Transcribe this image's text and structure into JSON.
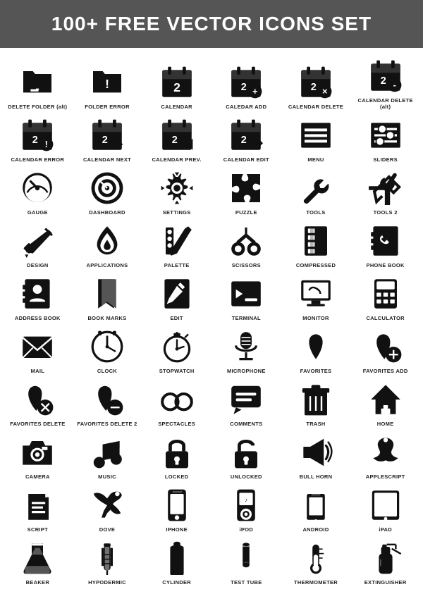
{
  "header": "100+ FREE VECTOR ICONS SET",
  "icons": [
    {
      "name": "DELETE FOLDER (alt)",
      "id": "delete-folder-alt"
    },
    {
      "name": "FOLDER ERROR",
      "id": "folder-error"
    },
    {
      "name": "CALENDAR",
      "id": "calendar"
    },
    {
      "name": "CALEDAR ADD",
      "id": "calendar-add"
    },
    {
      "name": "CALENDAR DELETE",
      "id": "calendar-delete"
    },
    {
      "name": "CALENDAR DELETE (alt)",
      "id": "calendar-delete-alt"
    },
    {
      "name": "CALENDAR ERROR",
      "id": "calendar-error"
    },
    {
      "name": "CALENDAR NEXT",
      "id": "calendar-next"
    },
    {
      "name": "CALENDAR PREV.",
      "id": "calendar-prev"
    },
    {
      "name": "CALENDAR EDIT",
      "id": "calendar-edit"
    },
    {
      "name": "MENU",
      "id": "menu"
    },
    {
      "name": "SLIDERS",
      "id": "sliders"
    },
    {
      "name": "GAUGE",
      "id": "gauge"
    },
    {
      "name": "DASHBOARD",
      "id": "dashboard"
    },
    {
      "name": "SETTINGS",
      "id": "settings"
    },
    {
      "name": "PUZZLE",
      "id": "puzzle"
    },
    {
      "name": "TOOLS",
      "id": "tools"
    },
    {
      "name": "TOOLS 2",
      "id": "tools2"
    },
    {
      "name": "DESIGN",
      "id": "design"
    },
    {
      "name": "APPLICATIONS",
      "id": "applications"
    },
    {
      "name": "PALETTE",
      "id": "palette"
    },
    {
      "name": "SCISSORS",
      "id": "scissors"
    },
    {
      "name": "COMPRESSED",
      "id": "compressed"
    },
    {
      "name": "PHONE BOOK",
      "id": "phone-book"
    },
    {
      "name": "ADDRESS BOOK",
      "id": "address-book"
    },
    {
      "name": "BOOK MARKS",
      "id": "bookmarks"
    },
    {
      "name": "EDIT",
      "id": "edit"
    },
    {
      "name": "TERMINAL",
      "id": "terminal"
    },
    {
      "name": "MONITOR",
      "id": "monitor"
    },
    {
      "name": "CALCULATOR",
      "id": "calculator"
    },
    {
      "name": "MAIL",
      "id": "mail"
    },
    {
      "name": "CLOCK",
      "id": "clock"
    },
    {
      "name": "STOPWATCH",
      "id": "stopwatch"
    },
    {
      "name": "MICROPHONE",
      "id": "microphone"
    },
    {
      "name": "FAVORITES",
      "id": "favorites"
    },
    {
      "name": "FAVORITES ADD",
      "id": "favorites-add"
    },
    {
      "name": "FAVORITES DELETE",
      "id": "favorites-delete"
    },
    {
      "name": "FAVORITES DELETE 2",
      "id": "favorites-delete2"
    },
    {
      "name": "SPECTACLES",
      "id": "spectacles"
    },
    {
      "name": "COMMENTS",
      "id": "comments"
    },
    {
      "name": "TRASH",
      "id": "trash"
    },
    {
      "name": "HOME",
      "id": "home"
    },
    {
      "name": "CAMERA",
      "id": "camera"
    },
    {
      "name": "MUSIC",
      "id": "music"
    },
    {
      "name": "LOCKED",
      "id": "locked"
    },
    {
      "name": "UNLOCKED",
      "id": "unlocked"
    },
    {
      "name": "BULL HORN",
      "id": "bullhorn"
    },
    {
      "name": "APPLESCRIPT",
      "id": "applescript"
    },
    {
      "name": "SCRIPT",
      "id": "script"
    },
    {
      "name": "DOVE",
      "id": "dove"
    },
    {
      "name": "IPHONE",
      "id": "iphone"
    },
    {
      "name": "iPOD",
      "id": "ipod"
    },
    {
      "name": "ANDROID",
      "id": "android"
    },
    {
      "name": "iPAD",
      "id": "ipad"
    },
    {
      "name": "BEAKER",
      "id": "beaker"
    },
    {
      "name": "HYPODERMIC",
      "id": "hypodermic"
    },
    {
      "name": "CYLINDER",
      "id": "cylinder"
    },
    {
      "name": "TEST TUBE",
      "id": "test-tube"
    },
    {
      "name": "THERMOMETER",
      "id": "thermometer"
    },
    {
      "name": "EXTINGUISHER",
      "id": "extinguisher"
    }
  ]
}
